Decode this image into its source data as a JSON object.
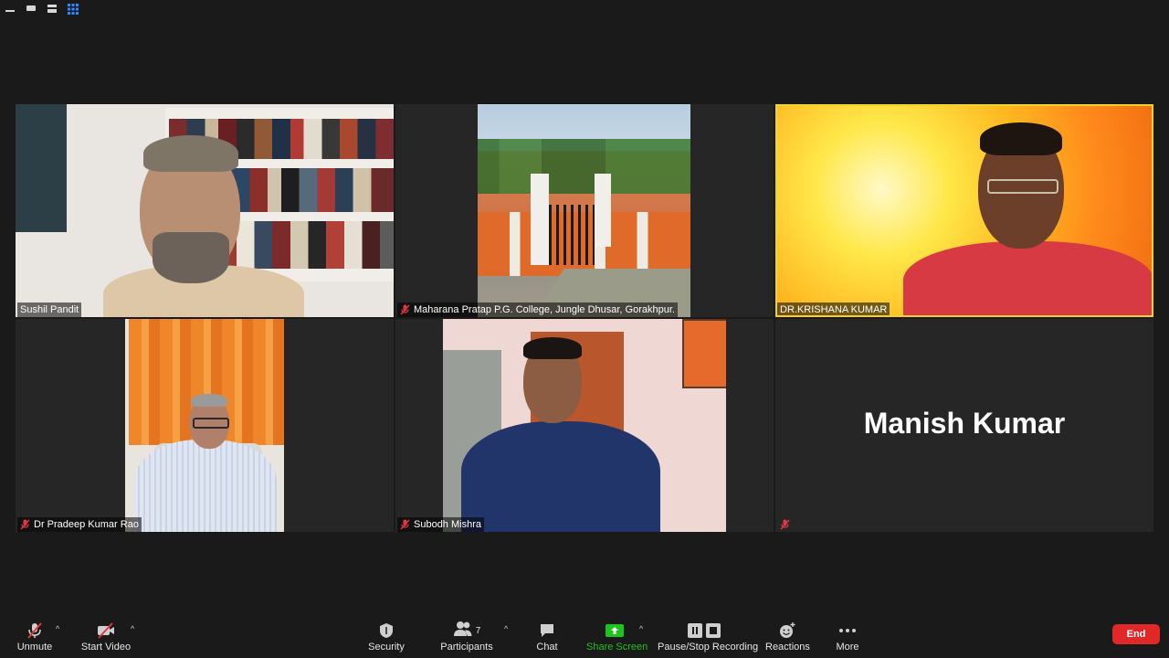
{
  "participants": [
    {
      "name": "Sushil Pandit",
      "muted": false
    },
    {
      "name": "Maharana Pratap P.G. College, Jungle Dhusar, Gorakhpur.",
      "muted": true
    },
    {
      "name": "DR.KRISHANA KUMAR",
      "muted": false,
      "active_speaker": true
    },
    {
      "name": "Dr Pradeep Kumar Rao",
      "muted": true
    },
    {
      "name": "Subodh Mishra",
      "muted": true
    },
    {
      "name": "Manish Kumar",
      "muted": true,
      "video_off": true
    }
  ],
  "toolbar": {
    "unmute": "Unmute",
    "start_video": "Start Video",
    "security": "Security",
    "participants": "Participants",
    "participant_count": "7",
    "chat": "Chat",
    "share_screen": "Share Screen",
    "recording": "Pause/Stop Recording",
    "reactions": "Reactions",
    "more": "More",
    "end": "End"
  },
  "colors": {
    "background": "#1a1a1a",
    "tile": "#262626",
    "active_speaker_border": "#f2d22e",
    "share_screen": "#1dc41d",
    "end_button": "#e02828",
    "muted_icon": "#e0383e"
  },
  "icons": {
    "top_bar": [
      "minimize-icon",
      "gallery-strip-icon",
      "speaker-view-icon",
      "gallery-view-icon"
    ],
    "toolbar": [
      "mic-muted-icon",
      "video-off-icon",
      "shield-icon",
      "participants-icon",
      "chat-icon",
      "share-screen-icon",
      "recording-icon",
      "reactions-icon",
      "more-icon"
    ]
  }
}
